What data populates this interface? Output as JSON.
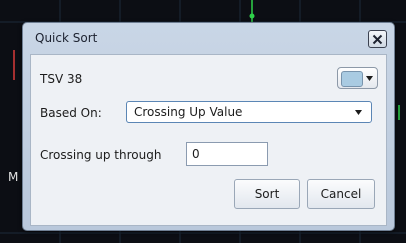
{
  "dialog": {
    "title": "Quick Sort",
    "close_icon": "close-icon"
  },
  "series": {
    "label": "TSV 38",
    "color": "#a9cbe2"
  },
  "based_on": {
    "label": "Based On:",
    "selected": "Crossing Up Value"
  },
  "crossing": {
    "label": "Crossing up through",
    "value": "0"
  },
  "buttons": {
    "sort": "Sort",
    "cancel": "Cancel"
  },
  "background": {
    "edge_letter": "M"
  }
}
